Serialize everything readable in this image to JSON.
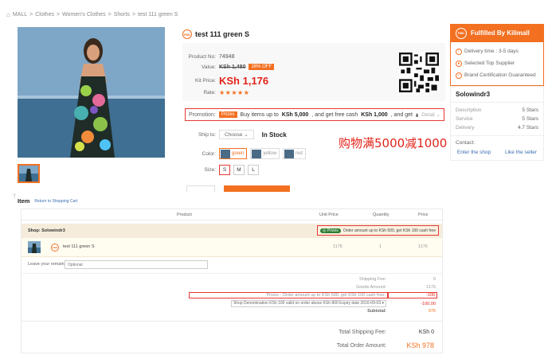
{
  "breadcrumb": [
    "MALL",
    "Clothes",
    "Women's Clothes",
    "Shorts",
    "test 111 green S"
  ],
  "breadcrumb_sep": ">",
  "badge_text": "FBK",
  "product": {
    "title": "test 111 green S",
    "product_no_label": "Product No:",
    "product_no": "74948",
    "value_label": "Value:",
    "value": "KSh 1,480",
    "off_badge": "16% OFF",
    "kit_price_label": "Kit Price:",
    "kit_price": "KSh 1,176",
    "rate_label": "Rate:",
    "rating_stars": 5,
    "rating_glyphs": "★★★★★"
  },
  "promotion": {
    "label": "Promotion:",
    "tag": "Prizes",
    "text_a": "Buy items up to",
    "amount_a": "KSh 5,000",
    "text_b": ", and get free cash",
    "amount_b": "KSh 1,000",
    "text_c": ", and get",
    "detail": "Detail",
    "detail_arrow": "⌄"
  },
  "ship": {
    "label": "Ship to:",
    "placeholder": "Choose",
    "chevron": "⌄",
    "stock": "In Stock"
  },
  "color": {
    "label": "Color:",
    "options": [
      "green",
      "yellow",
      "red"
    ],
    "selected": "green"
  },
  "size": {
    "label": "Size:",
    "options": [
      "S",
      "M",
      "L"
    ],
    "selected": "S"
  },
  "annotation": "购物满5000减1000",
  "fulfilled": {
    "title": "Fulfilled By Kilimall",
    "items": [
      {
        "icon": "!",
        "text": "Delivery time : 3-5 days"
      },
      {
        "icon": "●",
        "text": "Selected Top Supplier"
      },
      {
        "icon": "✓",
        "text": "Brand Certification Guaranteed"
      }
    ]
  },
  "seller": {
    "name": "Solowindr3",
    "stats": [
      {
        "label": "Description",
        "value": "5 Stars"
      },
      {
        "label": "Service",
        "value": "5 Stars"
      },
      {
        "label": "Delivery",
        "value": "4.7 Stars"
      }
    ],
    "contact_label": "Contact:",
    "enter_shop": "Enter the shop",
    "like_seller": "Like the seller"
  },
  "cart": {
    "title": "Item",
    "return_link": "Return to Shopping Cart",
    "columns": {
      "product": "Product",
      "unit_price": "Unit Price",
      "quantity": "Quantity",
      "price": "Price"
    },
    "shop_label": "Shop: Solowindr3",
    "prize_tag": "Prizes",
    "prize_icon": "◎",
    "prize_text": "Order amount up to KSh 500, get KSh 100 cash free",
    "item": {
      "name": "test 111 green S",
      "unit_price": "1176",
      "quantity": "1",
      "price": "1176"
    },
    "remark_label": "Leave your remark:",
    "remark_placeholder": "Optional",
    "shipping_fee_label": "Shipping Fee:",
    "shipping_fee": "0",
    "goods_amount_label": "Goods Amount:",
    "goods_amount": "1176",
    "prizes_label": "Prizes - Order amount up to KSh 500, get KSh 100 cash free:",
    "prizes_value": "-100",
    "denomination_option": "Shop Denomination KSh 100 valid on order above KSh 800 Expiry date 2016-09-03",
    "denomination_chevron": "▾",
    "denomination_value": "-100.00",
    "subtotal_label": "Subtotal:",
    "subtotal": "976",
    "total_shipping_label": "Total Shipping Fee:",
    "total_shipping": "KSh 0",
    "total_order_label": "Total Order Amount:",
    "total_order": "KSh 978"
  },
  "colors": {
    "accent": "#f37021",
    "alert_red": "#e53935",
    "link_blue": "#3a6fb0",
    "price_red": "#e2231a"
  },
  "icons": [
    "home-icon",
    "fbk-badge-icon",
    "qr-code-icon",
    "person-icon",
    "cart-icon",
    "prize-icon"
  ]
}
